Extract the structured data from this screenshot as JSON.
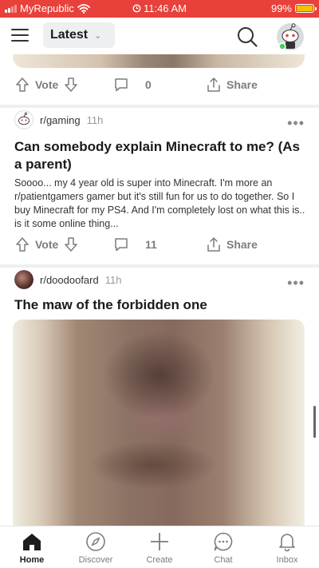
{
  "status_bar": {
    "carrier": "MyRepublic",
    "time": "11:46 AM",
    "battery": "99%",
    "battery_level": 0.99
  },
  "header": {
    "sort_label": "Latest"
  },
  "posts": [
    {
      "vote_label": "Vote",
      "comments": "0",
      "share_label": "Share"
    },
    {
      "subreddit": "r/gaming",
      "age": "11h",
      "more": "•••",
      "title": "Can somebody explain Minecraft to me? (As a parent)",
      "body": "Soooo... my 4 year old is super into Minecraft. I'm more an r/patientgamers gamer but it's still fun for us to do together. So I buy Minecraft for my PS4. And I'm completely lost on what this is.. is it some online thing...",
      "vote_label": "Vote",
      "comments": "11",
      "share_label": "Share"
    },
    {
      "subreddit": "r/doodoofard",
      "age": "11h",
      "more": "•••",
      "title": "The maw of the forbidden one"
    }
  ],
  "tabs": [
    {
      "label": "Home",
      "icon": "home-icon",
      "active": true
    },
    {
      "label": "Discover",
      "icon": "compass-icon"
    },
    {
      "label": "Create",
      "icon": "plus-icon"
    },
    {
      "label": "Chat",
      "icon": "chat-icon"
    },
    {
      "label": "Inbox",
      "icon": "bell-icon"
    }
  ],
  "colors": {
    "status_bar": "#e8403a",
    "text": "#1c1c1c",
    "muted": "#7c7c7c",
    "divider": "#edeff1"
  }
}
